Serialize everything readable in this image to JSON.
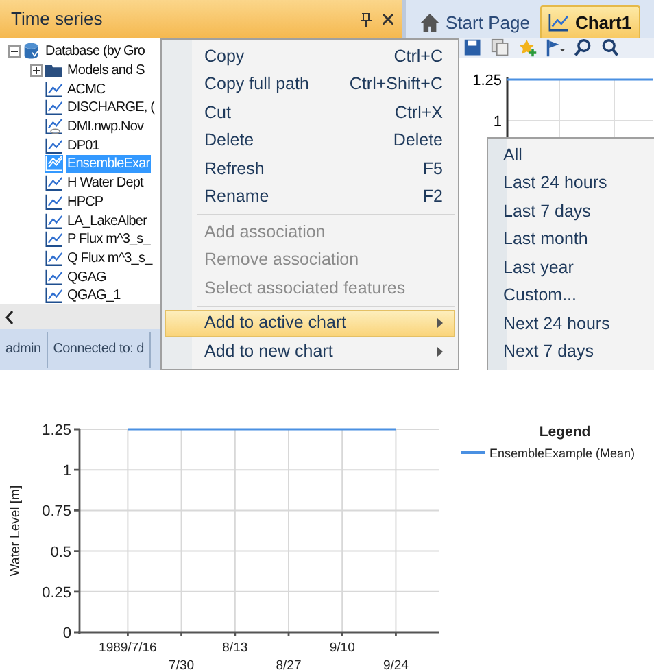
{
  "left_panel": {
    "title": "Time series",
    "tree": [
      {
        "label": "Database (by Gro",
        "kind": "database",
        "expanded": true,
        "selected": false,
        "children": [
          {
            "label": "Models and S",
            "kind": "folder",
            "expanded": false,
            "selected": false
          },
          {
            "label": "ACMC",
            "kind": "series",
            "selected": false
          },
          {
            "label": "DISCHARGE, (",
            "kind": "series",
            "selected": false
          },
          {
            "label": "DMI.nwp.Nov",
            "kind": "linked",
            "selected": false
          },
          {
            "label": "DP01",
            "kind": "series",
            "selected": false
          },
          {
            "label": "EnsembleExar",
            "kind": "ensemble",
            "selected": true
          },
          {
            "label": "H Water Dept",
            "kind": "series",
            "selected": false
          },
          {
            "label": "HPCP",
            "kind": "series",
            "selected": false
          },
          {
            "label": "LA_LakeAlber",
            "kind": "series",
            "selected": false
          },
          {
            "label": "P Flux m^3_s_",
            "kind": "series",
            "selected": false
          },
          {
            "label": "Q Flux m^3_s_",
            "kind": "series",
            "selected": false
          },
          {
            "label": "QGAG",
            "kind": "series",
            "selected": false
          },
          {
            "label": "QGAG_1",
            "kind": "series",
            "selected": false
          }
        ]
      }
    ],
    "status_bar": [
      "admin",
      "Connected to: d"
    ]
  },
  "tabs": [
    {
      "label": "Start Page",
      "kind": "home",
      "selected": false
    },
    {
      "label": "Chart1",
      "kind": "chart",
      "selected": true
    }
  ],
  "mini_chart": {
    "yticks": [
      "1.25",
      "1"
    ]
  },
  "context_menu": [
    {
      "kind": "item",
      "label": "Copy",
      "shortcut": "Ctrl+C",
      "disabled": false,
      "selected": false,
      "submenu": false
    },
    {
      "kind": "item",
      "label": "Copy full path",
      "shortcut": "Ctrl+Shift+C",
      "disabled": false,
      "selected": false,
      "submenu": false
    },
    {
      "kind": "item",
      "label": "Cut",
      "shortcut": "Ctrl+X",
      "disabled": false,
      "selected": false,
      "submenu": false
    },
    {
      "kind": "item",
      "label": "Delete",
      "shortcut": "Delete",
      "disabled": false,
      "selected": false,
      "submenu": false
    },
    {
      "kind": "item",
      "label": "Refresh",
      "shortcut": "F5",
      "disabled": false,
      "selected": false,
      "submenu": false
    },
    {
      "kind": "item",
      "label": "Rename",
      "shortcut": "F2",
      "disabled": false,
      "selected": false,
      "submenu": false
    },
    {
      "kind": "separator"
    },
    {
      "kind": "item",
      "label": "Add association",
      "disabled": true,
      "selected": false,
      "submenu": false
    },
    {
      "kind": "item",
      "label": "Remove association",
      "disabled": true,
      "selected": false,
      "submenu": false
    },
    {
      "kind": "item",
      "label": "Select associated features",
      "disabled": true,
      "selected": false,
      "submenu": false
    },
    {
      "kind": "separator"
    },
    {
      "kind": "item",
      "label": "Add to active chart",
      "disabled": false,
      "selected": true,
      "submenu": true
    },
    {
      "kind": "item",
      "label": "Add to new chart",
      "disabled": false,
      "selected": false,
      "submenu": true
    }
  ],
  "submenu": [
    "All",
    "Last 24 hours",
    "Last 7 days",
    "Last month",
    "Last year",
    "Custom...",
    "Next 24 hours",
    "Next 7 days"
  ],
  "chart": {
    "legend_title": "Legend",
    "chart_data": {
      "type": "line",
      "ylabel": "Water Level [m]",
      "categories": [
        "1989/7/16",
        "7/30",
        "8/13",
        "8/27",
        "9/10",
        "9/24"
      ],
      "series": [
        {
          "name": "EnsembleExample (Mean)",
          "color": "#4a90e2",
          "values": [
            1.25,
            1.25,
            1.25,
            1.25,
            1.25,
            1.25
          ]
        }
      ],
      "ylim": [
        0,
        1.25
      ],
      "grid": true,
      "yticks": [
        0,
        0.25,
        0.5,
        0.75,
        1,
        1.25
      ]
    }
  }
}
